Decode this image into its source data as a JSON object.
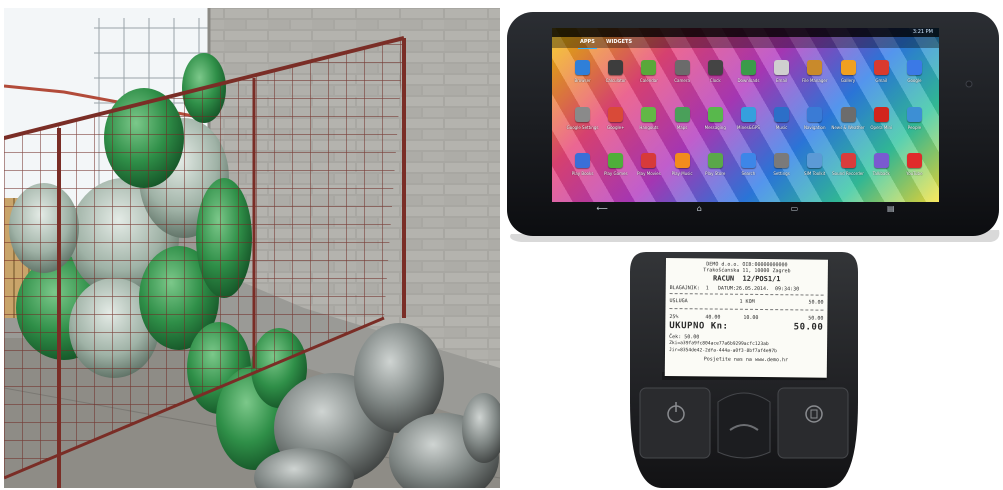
{
  "tablet": {
    "status_time": "3:21 PM",
    "tabs": [
      "APPS",
      "WIDGETS"
    ],
    "apps": [
      "Browser",
      "Calculator",
      "Calendar",
      "Camera",
      "Clock",
      "Downloads",
      "Email",
      "File Manager",
      "Gallery",
      "Gmail",
      "Google",
      "Google Settings",
      "Google+",
      "Hangouts",
      "Maps",
      "Messaging",
      "Mines&GPS",
      "Music",
      "Navigation",
      "News & Weather",
      "Opera Mini",
      "People",
      "Play Books",
      "Play Games",
      "Play Movies",
      "Play Music",
      "Play Store",
      "Search",
      "Settings",
      "SIM Toolkit",
      "Sound Recorder",
      "Talkback",
      "YouTube"
    ],
    "app_colors": [
      "#2f7fd8",
      "#3d3d3d",
      "#59a83a",
      "#6b6b6b",
      "#444444",
      "#3a9b4a",
      "#cfcfcf",
      "#c98a2b",
      "#f0a020",
      "#d93a2e",
      "#3b79e6",
      "#8a8a8a",
      "#d94a38",
      "#62b846",
      "#4aa05a",
      "#58b84c",
      "#35a0dd",
      "#2c6fc8",
      "#3a7bd5",
      "#6c6c6c",
      "#d2241c",
      "#3d8fd4",
      "#3a6fd8",
      "#4fae3a",
      "#d73a3a",
      "#f28c1c",
      "#5aa84a",
      "#3d86e8",
      "#7a7a7a",
      "#5c9ad6",
      "#d83c3c",
      "#7a5ad0",
      "#e02b2b"
    ]
  },
  "receipt": {
    "header_1": "DEMO d.o.o. OIB:00000000000",
    "header_2": "Trakošćanska 11, 10000 Zagreb",
    "title": "RACUN  12/POS1/1",
    "meta": "BLAGAJNIK:  1   DATUM:26.05.2014.  09:34:30",
    "item_name": "USLUGA",
    "item_qty": "1 KOM",
    "item_price": "50.00",
    "tax_rate": "25%",
    "tax_base": "40.00",
    "tax_amount": "10.00",
    "tax_total": "50.00",
    "total_label": "UKUPNO Kn:",
    "total_value": "50.00",
    "payment": "Ček: 50.00",
    "zki": "Zki=a39fa9fc804ace77a6b9299acfc123ab",
    "jir": "Jir=8354de42-2dfa-444a-a0f3-8bf7af4e97b",
    "footer": "Posjetite nas na www.demo.hr"
  }
}
